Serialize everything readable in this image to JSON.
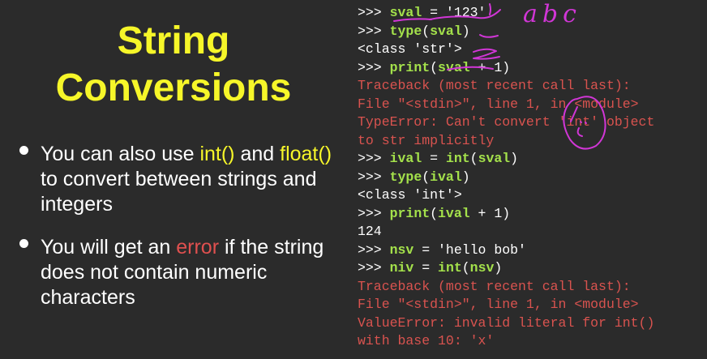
{
  "slide": {
    "title_line1": "String",
    "title_line2": "Conversions",
    "bullets": [
      {
        "parts": [
          {
            "text": "You can also use ",
            "style": "white"
          },
          {
            "text": "int()",
            "style": "yellow"
          },
          {
            "text": " and ",
            "style": "white"
          },
          {
            "text": "float()",
            "style": "yellow"
          },
          {
            "text": " to convert between strings and integers",
            "style": "white"
          }
        ]
      },
      {
        "parts": [
          {
            "text": "You will get an ",
            "style": "white"
          },
          {
            "text": "error",
            "style": "red"
          },
          {
            "text": " if the string does not contain numeric characters",
            "style": "white"
          }
        ]
      }
    ]
  },
  "code": {
    "lines": [
      {
        "prompt": ">>> ",
        "segments": [
          {
            "text": "sval",
            "c": "green"
          },
          {
            "text": " = '123'",
            "c": "white"
          }
        ]
      },
      {
        "prompt": ">>> ",
        "segments": [
          {
            "text": "type",
            "c": "green"
          },
          {
            "text": "(",
            "c": "white"
          },
          {
            "text": "sval",
            "c": "green"
          },
          {
            "text": ")",
            "c": "white"
          }
        ]
      },
      {
        "prompt": "",
        "segments": [
          {
            "text": "<class 'str'>",
            "c": "white"
          }
        ]
      },
      {
        "prompt": ">>> ",
        "segments": [
          {
            "text": "print",
            "c": "green"
          },
          {
            "text": "(",
            "c": "white"
          },
          {
            "text": "sval",
            "c": "green"
          },
          {
            "text": " + 1)",
            "c": "white"
          }
        ]
      },
      {
        "prompt": "",
        "segments": [
          {
            "text": "Traceback (most recent call last):",
            "c": "red"
          }
        ]
      },
      {
        "prompt": "",
        "segments": [
          {
            "text": "File \"<stdin>\", line 1, in <module>",
            "c": "red"
          }
        ]
      },
      {
        "prompt": "",
        "segments": [
          {
            "text": "TypeError: Can't convert 'int' object",
            "c": "red"
          }
        ]
      },
      {
        "prompt": "",
        "segments": [
          {
            "text": "to str implicitly",
            "c": "red"
          }
        ]
      },
      {
        "prompt": ">>> ",
        "segments": [
          {
            "text": "ival",
            "c": "green"
          },
          {
            "text": " = ",
            "c": "white"
          },
          {
            "text": "int",
            "c": "green"
          },
          {
            "text": "(",
            "c": "white"
          },
          {
            "text": "sval",
            "c": "green"
          },
          {
            "text": ")",
            "c": "white"
          }
        ]
      },
      {
        "prompt": ">>> ",
        "segments": [
          {
            "text": "type",
            "c": "green"
          },
          {
            "text": "(",
            "c": "white"
          },
          {
            "text": "ival",
            "c": "green"
          },
          {
            "text": ")",
            "c": "white"
          }
        ]
      },
      {
        "prompt": "",
        "segments": [
          {
            "text": "<class 'int'>",
            "c": "white"
          }
        ]
      },
      {
        "prompt": ">>> ",
        "segments": [
          {
            "text": "print",
            "c": "green"
          },
          {
            "text": "(",
            "c": "white"
          },
          {
            "text": "ival",
            "c": "green"
          },
          {
            "text": " + 1)",
            "c": "white"
          }
        ]
      },
      {
        "prompt": "",
        "segments": [
          {
            "text": "124",
            "c": "white"
          }
        ]
      },
      {
        "prompt": ">>> ",
        "segments": [
          {
            "text": "nsv",
            "c": "green"
          },
          {
            "text": " = 'hello bob'",
            "c": "white"
          }
        ]
      },
      {
        "prompt": ">>> ",
        "segments": [
          {
            "text": "niv",
            "c": "green"
          },
          {
            "text": " = ",
            "c": "white"
          },
          {
            "text": "int",
            "c": "green"
          },
          {
            "text": "(",
            "c": "white"
          },
          {
            "text": "nsv",
            "c": "green"
          },
          {
            "text": ")",
            "c": "white"
          }
        ]
      },
      {
        "prompt": "",
        "segments": [
          {
            "text": "Traceback (most recent call last):",
            "c": "red"
          }
        ]
      },
      {
        "prompt": "",
        "segments": [
          {
            "text": "File \"<stdin>\", line 1, in <module>",
            "c": "red"
          }
        ]
      },
      {
        "prompt": "",
        "segments": [
          {
            "text": "ValueError: invalid literal for int()",
            "c": "red"
          }
        ]
      },
      {
        "prompt": "",
        "segments": [
          {
            "text": "with base 10: 'x'",
            "c": "red"
          }
        ]
      }
    ]
  },
  "annotation": {
    "handwritten_text": "abc",
    "ink_color": "#d136d6"
  },
  "colors": {
    "background": "#2b2b2b",
    "title": "#f6f629",
    "code_green": "#a4e14b",
    "code_red": "#d9534f"
  }
}
